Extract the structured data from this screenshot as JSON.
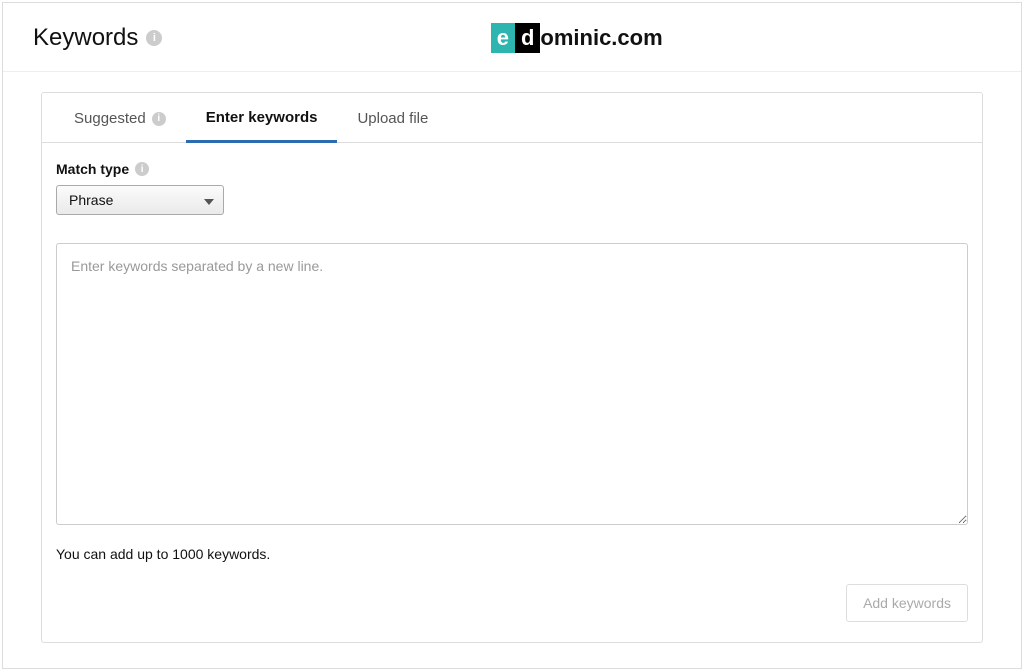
{
  "header": {
    "title": "Keywords",
    "logo": {
      "part1": "e",
      "part2": "d",
      "rest": "ominic.com"
    }
  },
  "tabs": {
    "suggested": "Suggested",
    "enter_keywords": "Enter keywords",
    "upload_file": "Upload file"
  },
  "match_type": {
    "label": "Match type",
    "selected": "Phrase"
  },
  "textarea": {
    "placeholder": "Enter keywords separated by a new line."
  },
  "helper_text": "You can add up to 1000 keywords.",
  "add_button_label": "Add keywords"
}
